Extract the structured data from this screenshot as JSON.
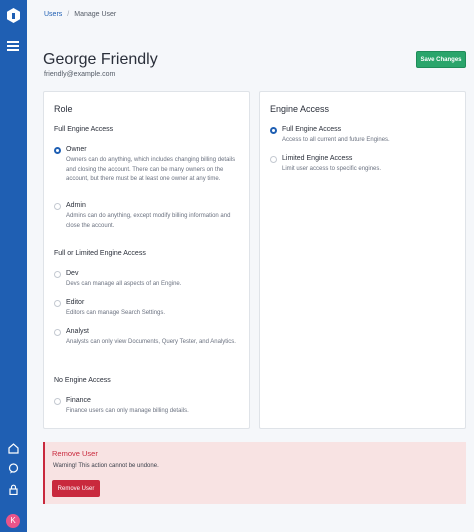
{
  "breadcrumb": {
    "link": "Users",
    "separator": "/",
    "current": "Manage User"
  },
  "user": {
    "name": "George Friendly",
    "email": "friendly@example.com"
  },
  "header": {
    "save_label": "Save Changes"
  },
  "sidebar": {
    "avatar_initial": "K",
    "icons": [
      "logo-icon",
      "menu-icon",
      "home-icon",
      "chat-icon",
      "lock-icon"
    ]
  },
  "role": {
    "title": "Role",
    "full_group": "Full Engine Access",
    "limited_group": "Full or Limited Engine Access",
    "none_group": "No Engine Access",
    "owner": {
      "label": "Owner",
      "desc": "Owners can do anything, which includes changing billing details and closing the account. There can be many owners on the account, but there must be at least one owner at any time."
    },
    "admin": {
      "label": "Admin",
      "desc": "Admins can do anything, except modify billing information and close the account."
    },
    "dev": {
      "label": "Dev",
      "desc": "Devs can manage all aspects of an Engine."
    },
    "editor": {
      "label": "Editor",
      "desc": "Editors can manage Search Settings."
    },
    "analyst": {
      "label": "Analyst",
      "desc": "Analysts can only view Documents, Query Tester, and Analytics."
    },
    "finance": {
      "label": "Finance",
      "desc": "Finance users can only manage billing details."
    },
    "selected": "Owner"
  },
  "engine": {
    "title": "Engine Access",
    "full": {
      "label": "Full Engine Access",
      "desc": "Access to all current and future Engines."
    },
    "limited": {
      "label": "Limited Engine Access",
      "desc": "Limit user access to specific engines."
    },
    "selected": "Full Engine Access"
  },
  "danger": {
    "title": "Remove User",
    "warning": "Warning! This action cannot be undone.",
    "button": "Remove User"
  },
  "colors": {
    "sidebar": "#1f5fb3",
    "save": "#2aa56b",
    "danger": "#c9293d",
    "danger_bg": "#f8e3e3",
    "avatar": "#e9548a"
  }
}
